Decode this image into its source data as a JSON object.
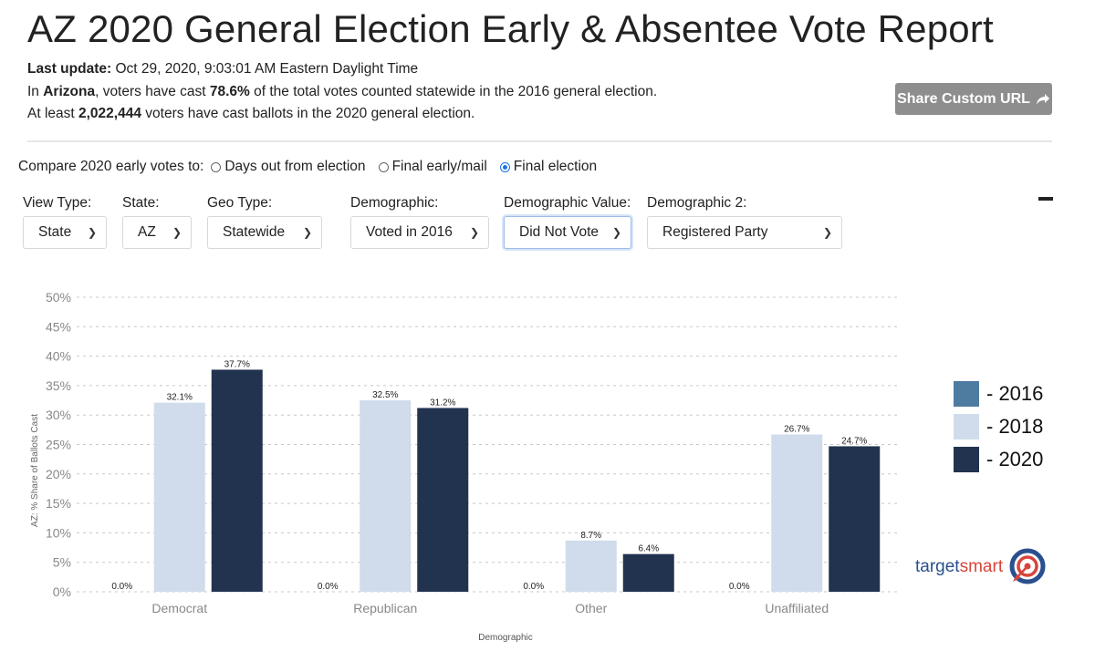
{
  "header": {
    "title": "AZ 2020 General Election Early & Absentee Vote Report",
    "last_update_label": "Last update:",
    "last_update_value": " Oct 29, 2020, 9:03:01 AM Eastern Daylight Time",
    "line2_pre": "In ",
    "line2_state": "Arizona",
    "line2_mid": ", voters have cast ",
    "line2_pct": "78.6%",
    "line2_post": " of the total votes counted statewide in the 2016 general election.",
    "line3_pre": "At least ",
    "line3_count": "2,022,444",
    "line3_post": " voters have cast ballots in the 2020 general election.",
    "share_button": "Share Custom URL"
  },
  "compare": {
    "label": "Compare 2020 early votes to:",
    "options": [
      {
        "label": "Days out from election",
        "selected": false
      },
      {
        "label": "Final early/mail",
        "selected": false
      },
      {
        "label": "Final election",
        "selected": true
      }
    ]
  },
  "filters": [
    {
      "label": "View Type:",
      "value": "State"
    },
    {
      "label": "State:",
      "value": "AZ"
    },
    {
      "label": "Geo Type:",
      "value": "Statewide"
    },
    {
      "label": "Demographic:",
      "value": "Voted in 2016"
    },
    {
      "label": "Demographic Value:",
      "value": "Did Not Vote"
    },
    {
      "label": "Demographic 2:",
      "value": "Registered Party"
    }
  ],
  "colors": {
    "s2016": "#4e7ca1",
    "s2018": "#d0dceb",
    "s2020": "#21334f",
    "grid": "#c8c8c8",
    "tick": "#888888"
  },
  "logo": {
    "part1": "target",
    "part2": "smart"
  },
  "chart_data": {
    "type": "bar",
    "title": "",
    "xlabel": "Demographic",
    "ylabel": "AZ: % Share of Ballots Cast",
    "ylim": [
      0,
      50
    ],
    "yticks": [
      "0%",
      "5%",
      "10%",
      "15%",
      "20%",
      "25%",
      "30%",
      "35%",
      "40%",
      "45%",
      "50%"
    ],
    "grid": true,
    "legend_position": "right",
    "categories": [
      "Democrat",
      "Republican",
      "Other",
      "Unaffiliated"
    ],
    "series": [
      {
        "name": "- 2016",
        "values": [
          0.0,
          0.0,
          0.0,
          0.0
        ],
        "labels": [
          "0.0%",
          "0.0%",
          "0.0%",
          "0.0%"
        ]
      },
      {
        "name": "- 2018",
        "values": [
          32.1,
          32.5,
          8.7,
          26.7
        ],
        "labels": [
          "32.1%",
          "32.5%",
          "8.7%",
          "26.7%"
        ]
      },
      {
        "name": "- 2020",
        "values": [
          37.7,
          31.2,
          6.4,
          24.7
        ],
        "labels": [
          "37.7%",
          "31.2%",
          "6.4%",
          "24.7%"
        ]
      }
    ]
  }
}
